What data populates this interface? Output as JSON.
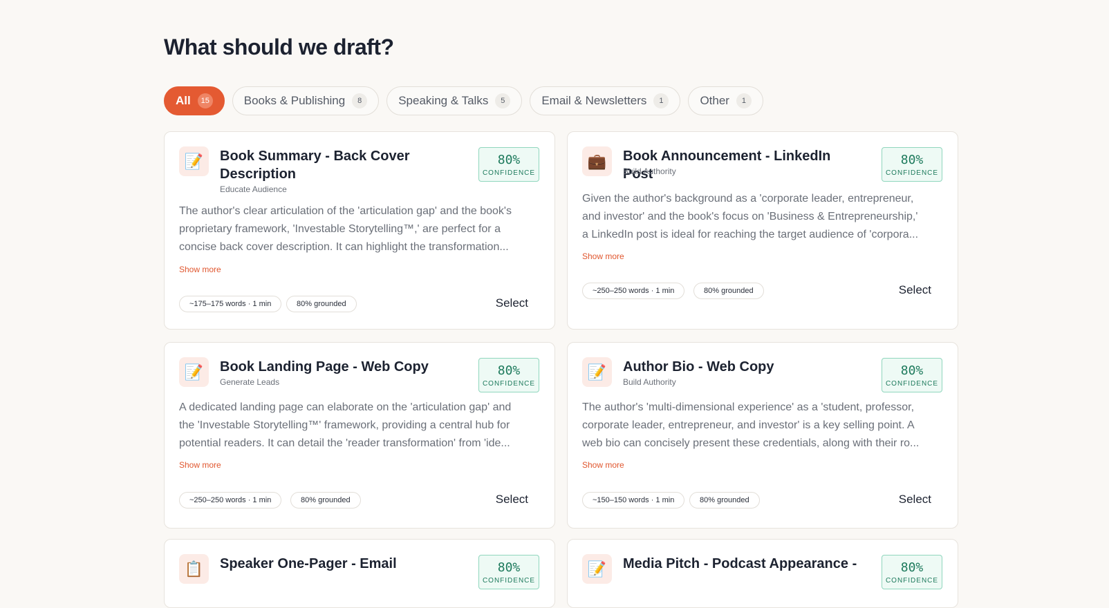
{
  "heading": "What should we draft?",
  "tabs": [
    {
      "label": "All",
      "count": "15"
    },
    {
      "label": "Books & Publishing",
      "count": "8"
    },
    {
      "label": "Speaking & Talks",
      "count": "5"
    },
    {
      "label": "Email & Newsletters",
      "count": "1"
    },
    {
      "label": "Other",
      "count": "1"
    }
  ],
  "cards": [
    {
      "icon": "memo-icon",
      "glyph": "📝",
      "title": "Book Summary - Back Cover Description",
      "subtitle": "Educate Audience",
      "confidence": "80%",
      "confidence_label": "CONFIDENCE",
      "desc_lines": [
        "The author's clear articulation of the 'articulation gap' and the book's",
        "proprietary framework, 'Investable Storytelling™,' are perfect for a",
        "concise back cover description. It can highlight the transformation..."
      ],
      "show_more": "Show more",
      "words": "~175–175 words · 1 min",
      "grounded": "80% grounded",
      "select": "Select"
    },
    {
      "icon": "briefcase-icon",
      "glyph": "💼",
      "title": "Book Announcement - LinkedIn Post",
      "subtitle": "Build Authority",
      "confidence": "80%",
      "confidence_label": "CONFIDENCE",
      "desc_lines": [
        "Given the author's background as a 'corporate leader, entrepreneur,",
        "and investor' and the book's focus on 'Business & Entrepreneurship,'",
        "a LinkedIn post is ideal for reaching the target audience of 'corpora..."
      ],
      "show_more": "Show more",
      "words": "~250–250 words · 1 min",
      "grounded": "80% grounded",
      "select": "Select"
    },
    {
      "icon": "memo-icon",
      "glyph": "📝",
      "title": "Book Landing Page - Web Copy",
      "subtitle": "Generate Leads",
      "confidence": "80%",
      "confidence_label": "CONFIDENCE",
      "desc_lines": [
        "A dedicated landing page can elaborate on the 'articulation gap' and",
        "the 'Investable Storytelling™' framework, providing a central hub for",
        "potential readers. It can detail the 'reader transformation' from 'ide..."
      ],
      "show_more": "Show more",
      "words": "~250–250 words · 1 min",
      "grounded": "80% grounded",
      "select": "Select"
    },
    {
      "icon": "memo-icon",
      "glyph": "📝",
      "title": "Author Bio - Web Copy",
      "subtitle": "Build Authority",
      "confidence": "80%",
      "confidence_label": "CONFIDENCE",
      "desc_lines": [
        "The author's 'multi-dimensional experience' as a 'student, professor,",
        "corporate leader, entrepreneur, and investor' is a key selling point. A",
        "web bio can concisely present these credentials, along with their ro..."
      ],
      "show_more": "Show more",
      "words": "~150–150 words · 1 min",
      "grounded": "80% grounded",
      "select": "Select"
    },
    {
      "icon": "clipboard-icon",
      "glyph": "📋",
      "title": "Speaker One-Pager - Email",
      "subtitle": "",
      "confidence": "80%",
      "confidence_label": "CONFIDENCE"
    },
    {
      "icon": "memo-icon",
      "glyph": "📝",
      "title": "Media Pitch - Podcast Appearance -",
      "subtitle": "",
      "confidence": "80%",
      "confidence_label": "CONFIDENCE"
    }
  ]
}
